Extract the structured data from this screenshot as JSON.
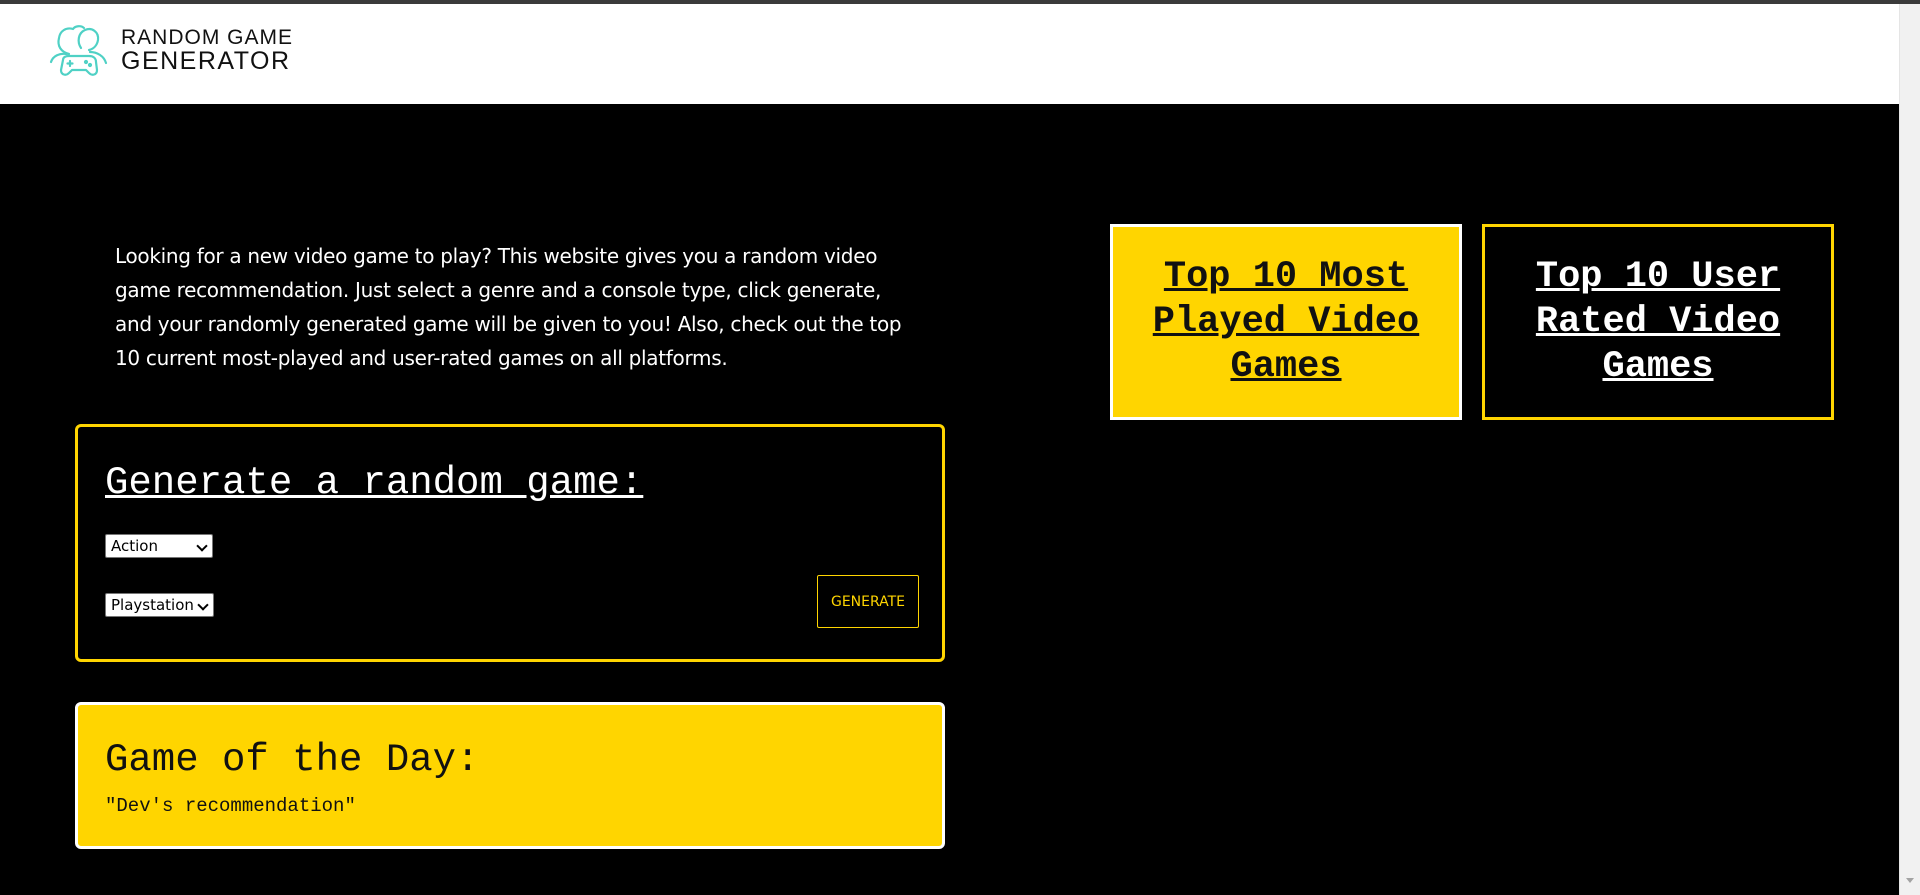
{
  "header": {
    "logo_line1": "RANDOM GAME",
    "logo_line2": "GENERATOR",
    "logo_icon": "people-gamepad-icon"
  },
  "intro": {
    "text": "Looking for a new video game to play? This website gives you a random video game recommendation. Just select a genre and a console type, click generate, and your randomly generated game will be given to you! Also, check out the top 10 current most-played and user-rated games on all platforms."
  },
  "top_links": {
    "most_played": "Top 10 Most Played Video Games",
    "user_rated": "Top 10 User Rated Video Games"
  },
  "generator": {
    "title": "Generate a random game:",
    "genre_value": "Action",
    "console_value": "Playstation",
    "button_label": "GENERATE"
  },
  "game_of_the_day": {
    "title": "Game of the Day:",
    "recommendation": "\"Dev's recommendation\""
  },
  "colors": {
    "accent": "#ffd500",
    "background": "#000000",
    "logo_teal": "#4fd1c5"
  }
}
